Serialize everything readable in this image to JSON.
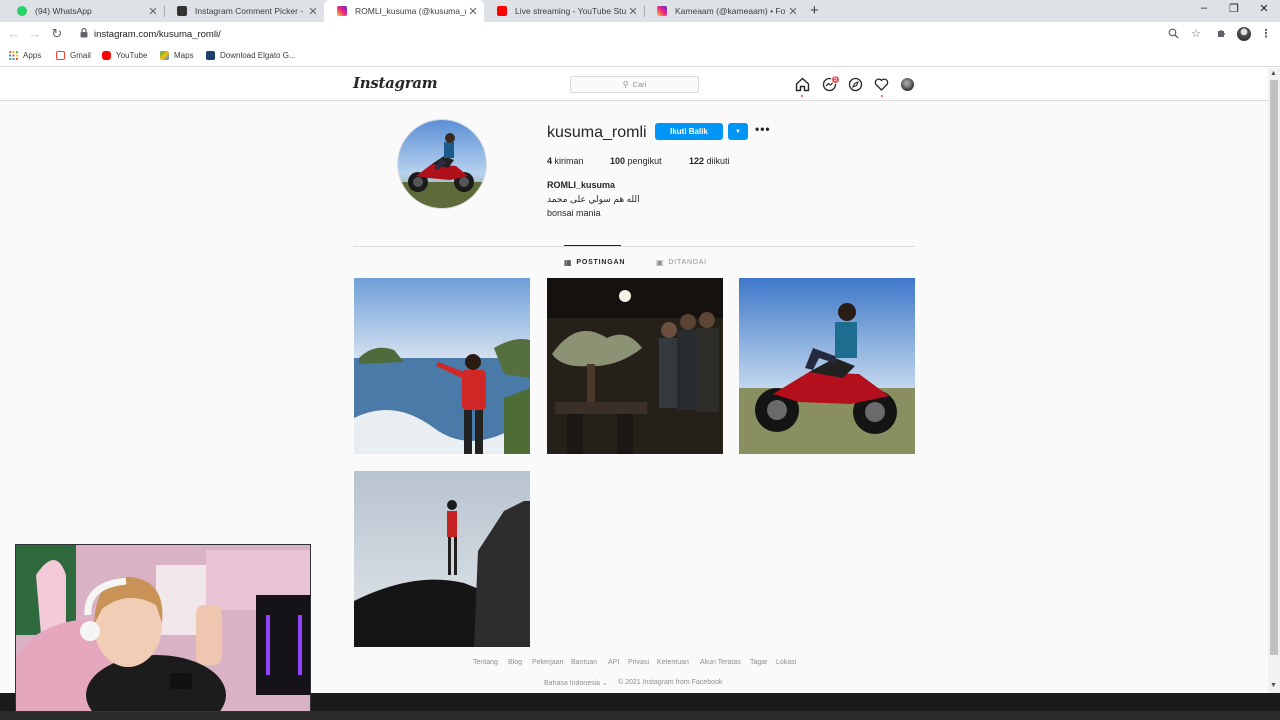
{
  "browser": {
    "tabs": [
      {
        "title": "(94) WhatsApp",
        "favicon": "whatsapp-icon",
        "color": "#25d366"
      },
      {
        "title": "Instagram Comment Picker - Free",
        "favicon": "comment-picker-icon",
        "color": "#333333"
      },
      {
        "title": "ROMLI_kusuma (@kusuma_romli)",
        "favicon": "instagram-icon",
        "color": "#d6249f"
      },
      {
        "title": "Live streaming - YouTube Studio",
        "favicon": "youtube-icon",
        "color": "#ff0000"
      },
      {
        "title": "Kameaam (@kameaam) • Foto dan",
        "favicon": "instagram-icon",
        "color": "#d6249f"
      }
    ],
    "url": "instagram.com/kusuma_romli/",
    "bookmarks": [
      {
        "label": "Apps",
        "icon": "apps-grid-icon",
        "color": "#ea4335"
      },
      {
        "label": "Gmail",
        "icon": "gmail-icon",
        "color": "#ea4335"
      },
      {
        "label": "YouTube",
        "icon": "youtube-icon",
        "color": "#ff0000"
      },
      {
        "label": "Maps",
        "icon": "maps-icon",
        "color": "#34a853"
      },
      {
        "label": "Download Elgato G...",
        "icon": "elgato-icon",
        "color": "#1c3f6e"
      }
    ]
  },
  "instagram": {
    "logo": "Instagram",
    "search_placeholder": "Cari",
    "messages_badge": "5",
    "profile": {
      "username": "kusuma_romli",
      "follow_label": "Ikuti Balik",
      "posts_count": "4",
      "posts_label": "kiriman",
      "followers_count": "100",
      "followers_label": "pengikut",
      "following_count": "122",
      "following_label": "diikuti",
      "display_name": "ROMLI_kusuma",
      "bio_line1": "الله هم سولي على محمد",
      "bio_line2": "bonsai mania"
    },
    "tabs": [
      {
        "label": "POSTINGAN",
        "icon": "grid-icon",
        "active": true
      },
      {
        "label": "DITANDAI",
        "icon": "tagged-icon",
        "active": false
      }
    ],
    "footer_links": [
      "Tentang",
      "Blog",
      "Pekerjaan",
      "Bantuan",
      "API",
      "Privasi",
      "Ketentuan",
      "Akun Teratas",
      "Tagar",
      "Lokasi"
    ],
    "language": "Bahasa Indonesia",
    "copyright": "© 2021 Instagram from Facebook",
    "colors": {
      "primary_button": "#0095f6",
      "notification": "#ed4956"
    }
  }
}
